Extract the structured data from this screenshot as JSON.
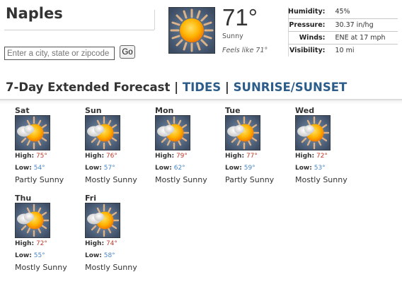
{
  "city": "Naples",
  "search": {
    "placeholder": "Enter a city, state or zipcode",
    "go_label": "Go"
  },
  "current": {
    "icon": "mostly-sunny-icon",
    "temperature": "71°",
    "condition": "Sunny",
    "feels_like": "Feels like 71°",
    "stats": [
      {
        "label": "Humidity:",
        "value": "45%"
      },
      {
        "label": "Pressure:",
        "value": "30.37 in/hg"
      },
      {
        "label": "Winds:",
        "value": "ENE at 17 mph"
      },
      {
        "label": "Visibility:",
        "value": "10 mi"
      }
    ]
  },
  "forecast": {
    "title": "7-Day Extended Forecast",
    "separator": "|",
    "links": [
      "TIDES",
      "SUNRISE/SUNSET"
    ],
    "high_label": "High:",
    "low_label": "Low:",
    "days": [
      {
        "name": "Sat",
        "high": "75°",
        "low": "54°",
        "condition": "Partly Sunny",
        "icon": "partly-sunny-icon"
      },
      {
        "name": "Sun",
        "high": "76°",
        "low": "57°",
        "condition": "Mostly Sunny",
        "icon": "mostly-sunny-icon"
      },
      {
        "name": "Mon",
        "high": "79°",
        "low": "62°",
        "condition": "Mostly Sunny",
        "icon": "mostly-sunny-icon"
      },
      {
        "name": "Tue",
        "high": "77°",
        "low": "59°",
        "condition": "Partly Sunny",
        "icon": "partly-sunny-icon"
      },
      {
        "name": "Wed",
        "high": "72°",
        "low": "53°",
        "condition": "Mostly Sunny",
        "icon": "mostly-sunny-icon"
      },
      {
        "name": "Thu",
        "high": "72°",
        "low": "55°",
        "condition": "Mostly Sunny",
        "icon": "mostly-sunny-icon"
      },
      {
        "name": "Fri",
        "high": "74°",
        "low": "58°",
        "condition": "Mostly Sunny",
        "icon": "mostly-sunny-icon"
      }
    ]
  },
  "colors": {
    "link": "#2b5c8a",
    "high": "#c0392b",
    "low": "#4a86c5"
  }
}
